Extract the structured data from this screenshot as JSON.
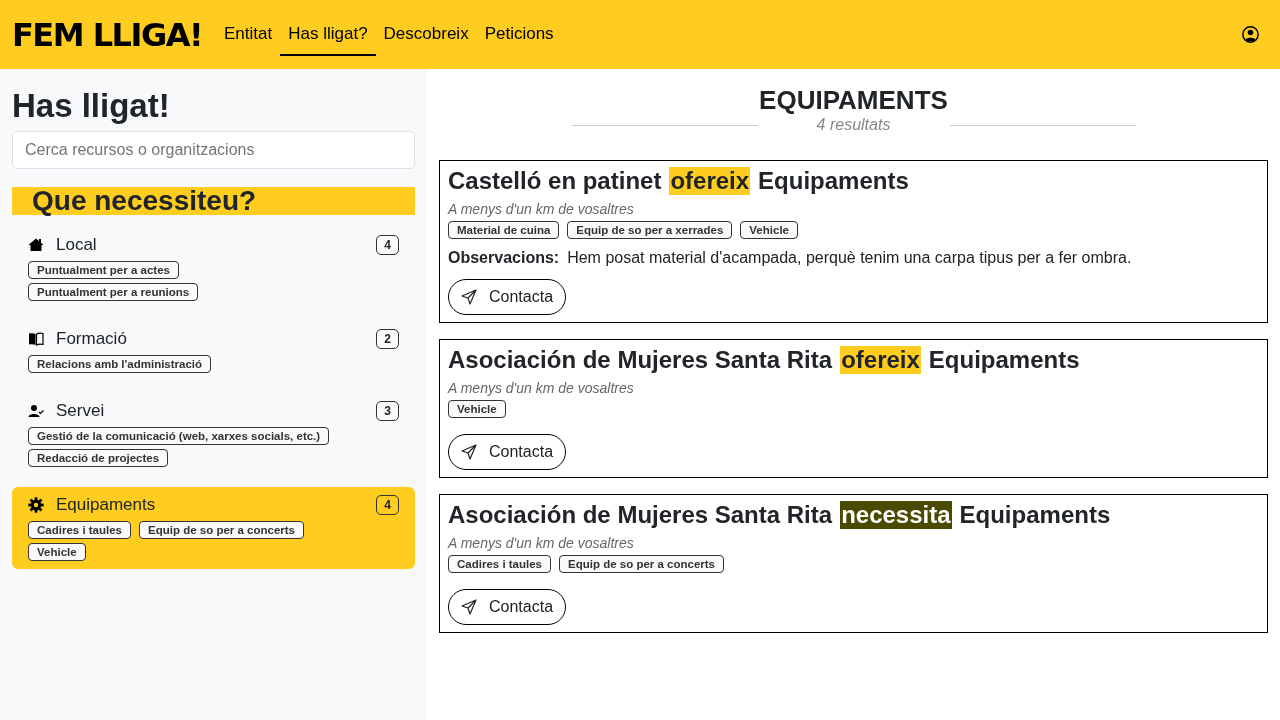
{
  "header": {
    "logo": "FEM LLIGA!",
    "nav": [
      {
        "label": "Entitat",
        "selected": false
      },
      {
        "label": "Has lligat?",
        "selected": true
      },
      {
        "label": "Descobreix",
        "selected": false
      },
      {
        "label": "Peticions",
        "selected": false
      }
    ]
  },
  "sidebar": {
    "title": "Has lligat!",
    "search": {
      "placeholder": "Cerca recursos o organitzacions"
    },
    "heading": "Que necessiteu?",
    "categories": [
      {
        "kind": "place",
        "label": "Local",
        "count": "4",
        "selected": false,
        "tags": [
          "Puntualment per a actes",
          "Puntualment per a reunions"
        ]
      },
      {
        "kind": "training",
        "label": "Formació",
        "count": "2",
        "selected": false,
        "tags": [
          "Relacions amb l'administració"
        ]
      },
      {
        "kind": "service",
        "label": "Servei",
        "count": "3",
        "selected": false,
        "tags": [
          "Gestió de la comunicació (web, xarxes socials, etc.)",
          "Redacció de projectes"
        ]
      },
      {
        "kind": "equipment",
        "label": "Equipaments",
        "count": "4",
        "selected": true,
        "tags": [
          "Cadires i taules",
          "Equip de so per a concerts",
          "Vehicle"
        ]
      }
    ]
  },
  "main": {
    "title": "EQUIPAMENTS",
    "results": "4 resultats",
    "cards": [
      {
        "org": "Castelló en patinet",
        "kind": "offer",
        "verb": "ofereix",
        "category": "Equipaments",
        "distance": "A menys d'un km de vosaltres",
        "tags": [
          "Material de cuina",
          "Equip de so per a xerrades",
          "Vehicle"
        ],
        "notes_label": "Observacions:",
        "notes": "Hem posat material d'acampada, perquè tenim una carpa tipus per a fer ombra.",
        "button": "Contacta"
      },
      {
        "org": "Asociación de Mujeres Santa Rita",
        "kind": "offer",
        "verb": "ofereix",
        "category": "Equipaments",
        "distance": "A menys d'un km de vosaltres",
        "tags": [
          "Vehicle"
        ],
        "button": "Contacta"
      },
      {
        "org": "Asociación de Mujeres Santa Rita",
        "kind": "need",
        "verb": "necessita",
        "category": "Equipaments",
        "distance": "A menys d'un km de vosaltres",
        "tags": [
          "Cadires i taules",
          "Equip de so per a concerts"
        ],
        "button": "Contacta"
      }
    ]
  }
}
